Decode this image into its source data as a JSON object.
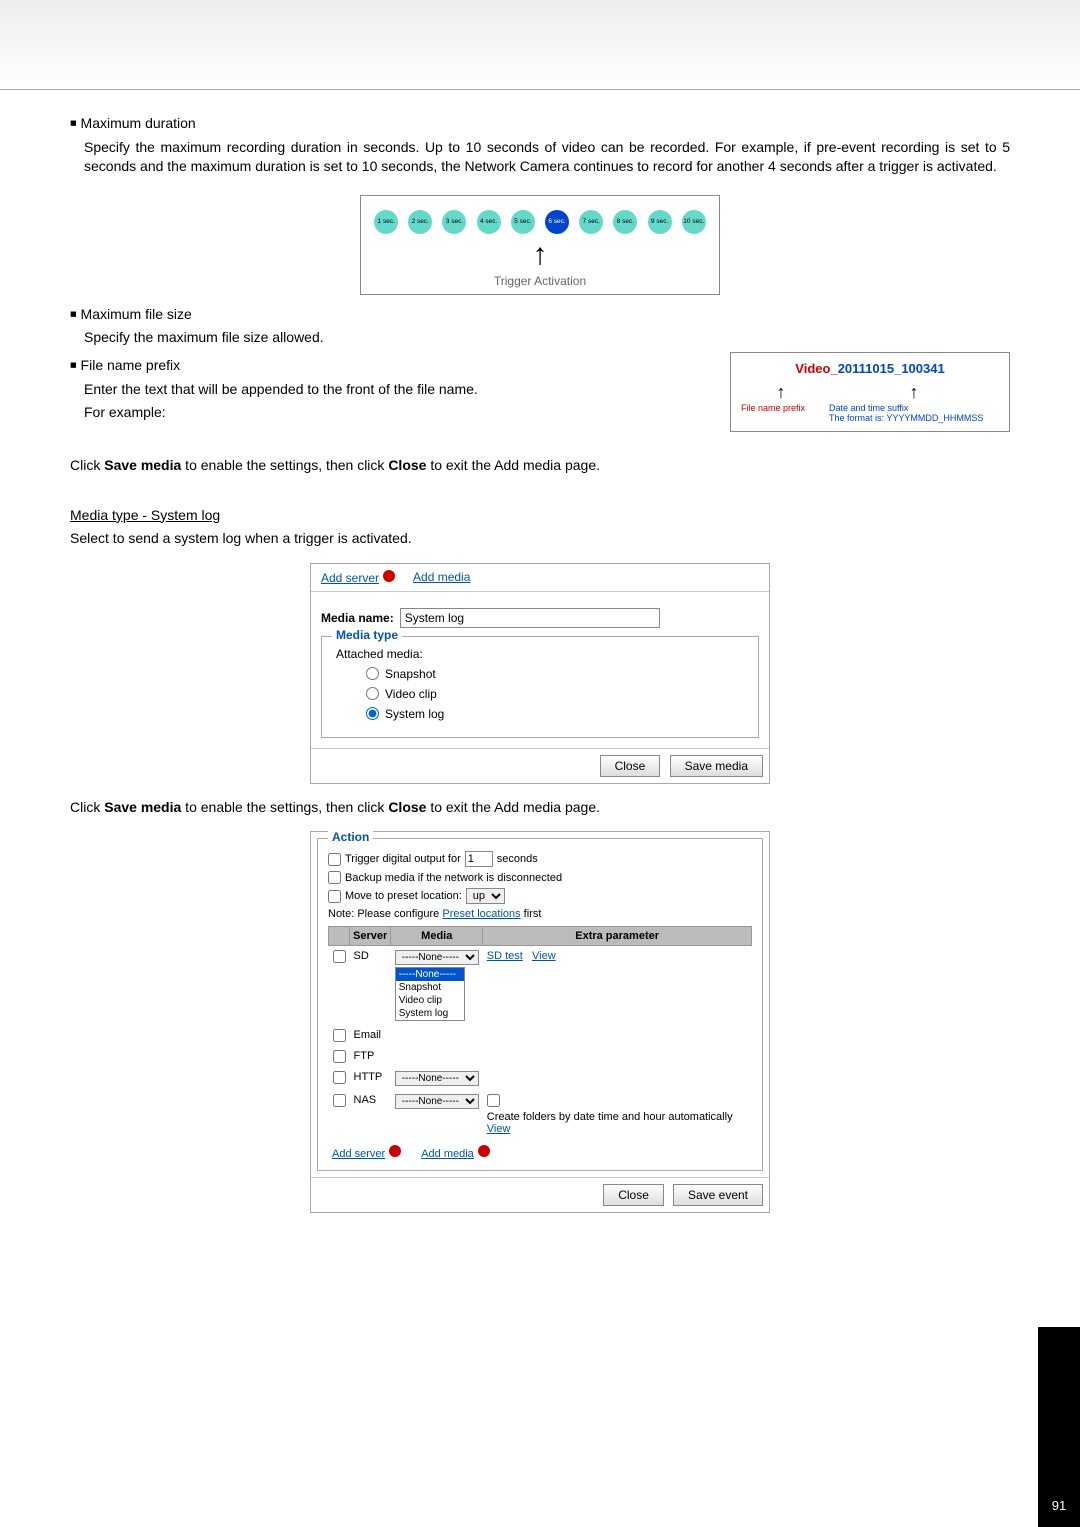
{
  "s1": {
    "title": "Maximum duration",
    "body": "Specify the maximum recording duration in seconds. Up to 10 seconds of video can be recorded. For example, if pre-event recording is set to 5 seconds and the maximum duration is set to 10 seconds, the Network Camera continues to record for another 4 seconds after a trigger is activated."
  },
  "timeline": {
    "secs": [
      "1 sec.",
      "2 sec.",
      "3 sec.",
      "4 sec.",
      "5 sec.",
      "6 sec.",
      "7 sec.",
      "8 sec.",
      "9 sec.",
      "10 sec."
    ],
    "active_index": 5,
    "label": "Trigger Activation"
  },
  "s2": {
    "title": "Maximum file size",
    "body": "Specify the maximum file size allowed."
  },
  "s3": {
    "title": "File name prefix",
    "body1": "Enter the text that will be appended to the front of the file name.",
    "body2": "For example:"
  },
  "prefix_diagram": {
    "example_prefix": "Video_",
    "example_suffix": "20111015_100341",
    "col1_label": "File name prefix",
    "col2_line1": "Date and time suffix",
    "col2_line2": "The format is: YYYYMMDD_HHMMSS"
  },
  "line_save1": {
    "a": "Click ",
    "b": "Save media",
    "c": " to enable the settings, then click ",
    "d": "Close",
    "e": " to exit the Add media page."
  },
  "mediatype_heading": "Media type - System log",
  "mediatype_body": "Select to send a system log when a trigger is activated.",
  "media_panel": {
    "add_server": "Add server",
    "add_media": "Add media",
    "media_name_label": "Media name:",
    "media_name_value": "System log",
    "fieldset_legend": "Media type",
    "attached_label": "Attached media:",
    "options": [
      "Snapshot",
      "Video clip",
      "System log"
    ],
    "selected_index": 2,
    "close": "Close",
    "save": "Save media"
  },
  "line_save2": {
    "a": "Click ",
    "b": "Save media",
    "c": " to enable the settings, then click ",
    "d": "Close",
    "e": " to exit the Add media page."
  },
  "action_panel": {
    "legend": "Action",
    "trigger_label_a": "Trigger digital output for",
    "trigger_value": "1",
    "trigger_label_b": "seconds",
    "backup_label": "Backup media if the network is disconnected",
    "preset_label": "Move to preset location:",
    "preset_value": "up",
    "note_a": "Note: Please configure ",
    "preset_link": "Preset locations",
    "note_b": " first",
    "headers": [
      "Server",
      "Media",
      "Extra parameter"
    ],
    "none_opt": "-----None-----",
    "dropdown_opts": [
      "-----None-----",
      "Snapshot",
      "Video clip",
      "System log"
    ],
    "rows": {
      "sd": {
        "name": "SD",
        "links": [
          "SD test",
          "View"
        ]
      },
      "email": {
        "name": "Email"
      },
      "ftp": {
        "name": "FTP"
      },
      "http": {
        "name": "HTTP"
      },
      "nas": {
        "name": "NAS",
        "extra": "Create folders by date time and hour automatically",
        "view": "View"
      }
    },
    "add_server": "Add server",
    "add_media": "Add media",
    "close": "Close",
    "save": "Save event"
  },
  "page_number": "91"
}
